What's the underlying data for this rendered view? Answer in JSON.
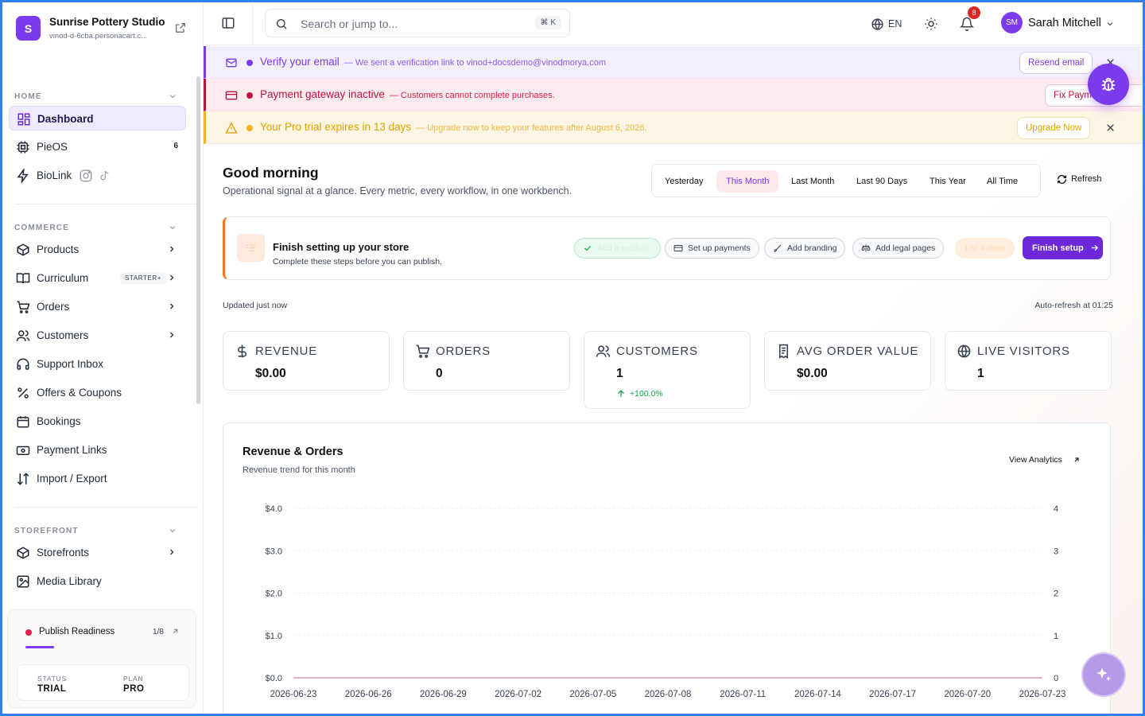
{
  "brand": {
    "initial": "S",
    "name": "Sunrise Pottery Studio",
    "url": "vinod-d-6cba.personacart.c..."
  },
  "sidebar": {
    "sections": [
      {
        "label": "HOME",
        "items": [
          {
            "label": "Dashboard",
            "active": true,
            "icon": "dashboard-icon"
          },
          {
            "label": "PieOS",
            "count": "6",
            "icon": "chip-icon"
          },
          {
            "label": "BioLink",
            "icon": "bolt-icon"
          }
        ]
      },
      {
        "label": "COMMERCE",
        "items": [
          {
            "label": "Products",
            "icon": "box-icon"
          },
          {
            "label": "Curriculum",
            "badge": "STARTER+",
            "icon": "book-icon"
          },
          {
            "label": "Orders",
            "icon": "cart-icon"
          },
          {
            "label": "Customers",
            "icon": "users-icon"
          },
          {
            "label": "Support Inbox",
            "icon": "headset-icon"
          },
          {
            "label": "Offers & Coupons",
            "icon": "percent-icon"
          },
          {
            "label": "Bookings",
            "icon": "calendar-icon"
          },
          {
            "label": "Payment Links",
            "icon": "payment-icon"
          },
          {
            "label": "Import / Export",
            "icon": "import-export-icon"
          }
        ]
      },
      {
        "label": "STOREFRONT",
        "items": [
          {
            "label": "Storefronts",
            "icon": "store-icon"
          },
          {
            "label": "Media Library",
            "icon": "image-icon"
          }
        ]
      }
    ],
    "publish": {
      "label": "Publish Readiness",
      "fraction": "1/8",
      "progress": 0.125,
      "status_key": "STATUS",
      "status_value": "TRIAL",
      "plan_key": "PLAN",
      "plan_value": "PRO"
    }
  },
  "topbar": {
    "search_placeholder": "Search or jump to...",
    "shortcut": "⌘ K",
    "lang": "EN",
    "notifications": "8",
    "avatar": "SM",
    "user": "Sarah Mitchell"
  },
  "banners": [
    {
      "title": "Verify your email",
      "message": "We sent a verification link to vinod+docsdemo@vinodmorya.com",
      "button": "Resend email",
      "bg": "#f4effc",
      "color": "#7c3aed",
      "msg_color": "#8b5cf6",
      "dot": "#7c3aed",
      "border": "#d9c8f7"
    },
    {
      "title": "Payment gateway inactive",
      "message": "Customers cannot complete purchases.",
      "button": "Fix Payments",
      "bg": "#fcecef",
      "color": "#be123c",
      "msg_color": "#e11d48",
      "dot": "#be123c",
      "border": "#f3c4cd"
    },
    {
      "title": "Your Pro trial expires in 13 days",
      "message": "Upgrade now to keep your features after August 6, 2026.",
      "button": "Upgrade Now",
      "bg": "#fdf6e4",
      "color": "#e0a100",
      "msg_color": "#efb73e",
      "dot": "#f5b324",
      "border": "#f5e2b0"
    }
  ],
  "main": {
    "greeting": "Good morning",
    "subtitle": "Operational signal at a glance. Every metric, every workflow, in one workbench.",
    "ranges": [
      "Yesterday",
      "This Month",
      "Last Month",
      "Last 90 Days",
      "This Year",
      "All Time"
    ],
    "active_range": "This Month",
    "refresh": "Refresh",
    "setup": {
      "title": "Finish setting up your store",
      "subtitle": "Complete these steps before you can publish.",
      "steps": [
        {
          "label": "Add a product",
          "done": true
        },
        {
          "label": "Set up payments",
          "done": false
        },
        {
          "label": "Add branding",
          "done": false
        },
        {
          "label": "Add legal pages",
          "done": false
        }
      ],
      "progress": "1 of 4 done",
      "cta": "Finish setup"
    },
    "updated": "Updated just now",
    "auto_refresh": "Auto-refresh at 01:25",
    "metrics": [
      {
        "label": "REVENUE",
        "value": "$0.00",
        "icon": "dollar-icon"
      },
      {
        "label": "ORDERS",
        "value": "0",
        "icon": "cart-icon"
      },
      {
        "label": "CUSTOMERS",
        "value": "1",
        "delta": "+100.0%",
        "icon": "users-icon"
      },
      {
        "label": "AVG ORDER VALUE",
        "value": "$0.00",
        "icon": "receipt-icon"
      },
      {
        "label": "LIVE VISITORS",
        "value": "1",
        "icon": "globe-icon"
      }
    ]
  },
  "chart_data": {
    "type": "line",
    "title": "Revenue & Orders",
    "subtitle": "Revenue trend for this month",
    "link": "View Analytics",
    "x": [
      "2026-06-23",
      "2026-06-26",
      "2026-06-29",
      "2026-07-02",
      "2026-07-05",
      "2026-07-08",
      "2026-07-11",
      "2026-07-14",
      "2026-07-17",
      "2026-07-20",
      "2026-07-23"
    ],
    "y_left_ticks": [
      "$4.0",
      "$3.0",
      "$2.0",
      "$1.0",
      "$0.0"
    ],
    "y_right_ticks": [
      "4",
      "3",
      "2",
      "1",
      "0"
    ],
    "ylim": [
      0,
      4
    ],
    "series": [
      {
        "values": [
          0,
          0,
          0,
          0,
          0,
          0,
          0,
          0,
          0,
          0,
          0
        ]
      },
      {
        "values": [
          0,
          0,
          0,
          0,
          0,
          0,
          0,
          0,
          0,
          0,
          0
        ]
      }
    ],
    "grid": true
  }
}
